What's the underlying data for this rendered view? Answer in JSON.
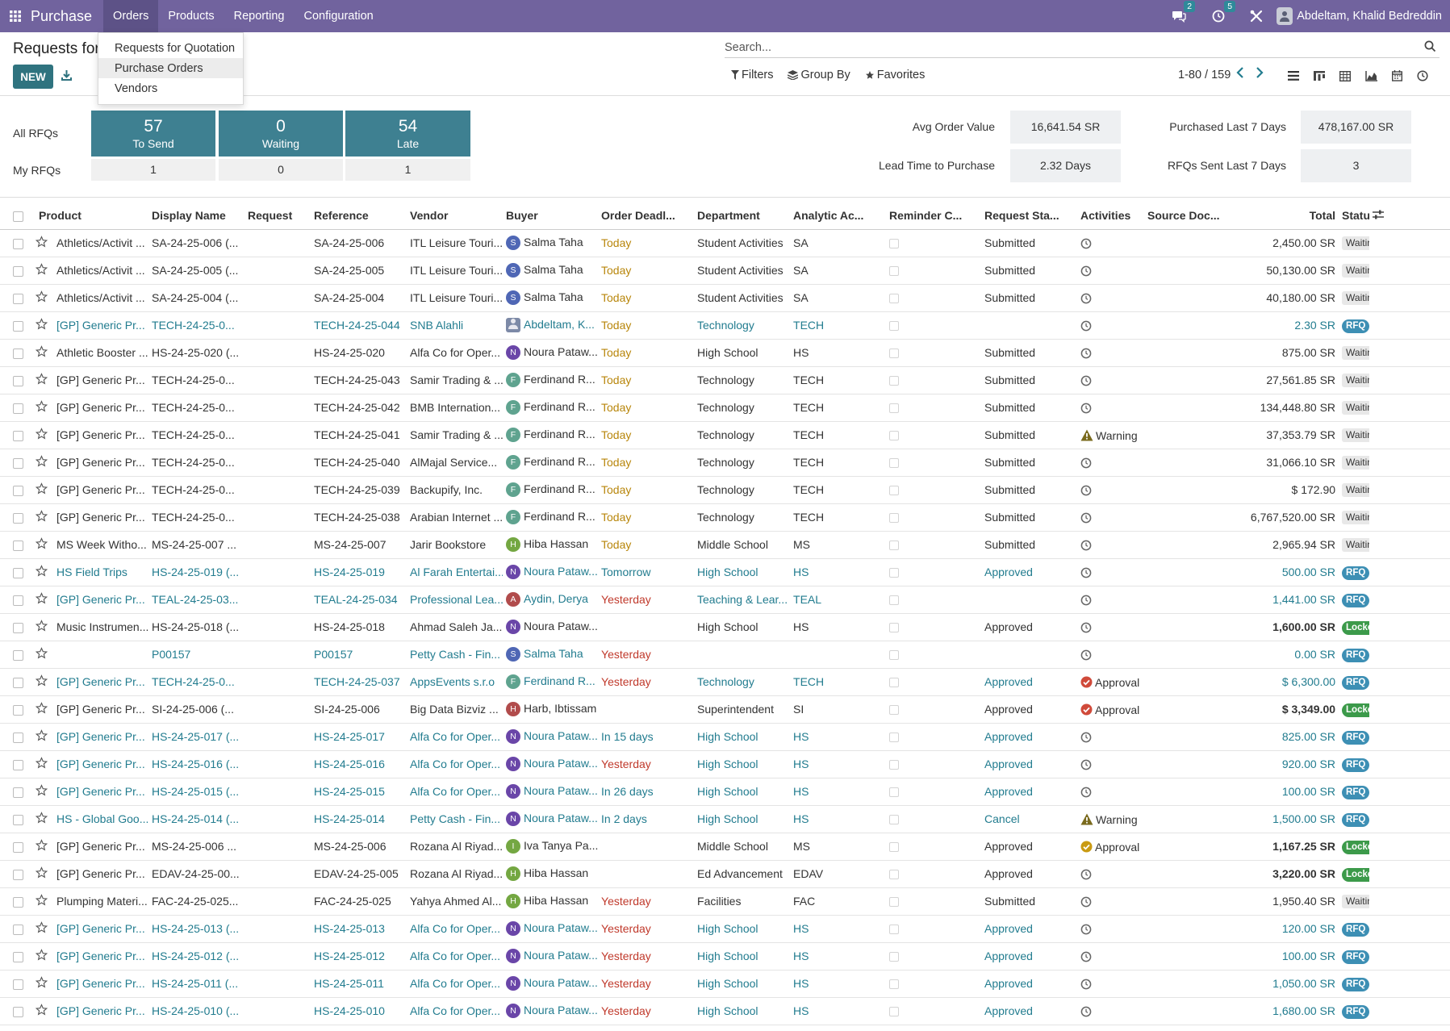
{
  "app": {
    "title": "Purchase"
  },
  "menu": [
    "Orders",
    "Products",
    "Reporting",
    "Configuration"
  ],
  "topbar": {
    "messages_count": "2",
    "activities_count": "5",
    "user_name": "Abdeltam, Khalid Bedreddin"
  },
  "dropdown": [
    "Requests for Quotation",
    "Purchase Orders",
    "Vendors"
  ],
  "page": {
    "title": "Requests for",
    "new_label": "NEW"
  },
  "search": {
    "placeholder": "Search..."
  },
  "filters": {
    "filters": "Filters",
    "group_by": "Group By",
    "favorites": "Favorites"
  },
  "pager": "1-80 / 159",
  "dashboard": {
    "all_rfqs": "All RFQs",
    "my_rfqs": "My RFQs",
    "tiles": [
      {
        "count": "57",
        "label": "To Send",
        "mine": "1"
      },
      {
        "count": "0",
        "label": "Waiting",
        "mine": "0"
      },
      {
        "count": "54",
        "label": "Late",
        "mine": "1"
      }
    ],
    "kpis": [
      {
        "label": "Avg Order Value",
        "value": "16,641.54 SR"
      },
      {
        "label": "Lead Time to Purchase",
        "value": "2.32 Days"
      },
      {
        "label": "Purchased Last 7 Days",
        "value": "478,167.00 SR"
      },
      {
        "label": "RFQs Sent Last 7 Days",
        "value": "3"
      }
    ]
  },
  "columns": [
    "Product",
    "Display Name",
    "Request",
    "Reference",
    "Vendor",
    "Buyer",
    "Order Deadl...",
    "Department",
    "Analytic Ac...",
    "Reminder C...",
    "Request Sta...",
    "Activities",
    "Source Doc...",
    "Total",
    "Status"
  ],
  "rows": [
    {
      "product": "Athletics/Activit ...",
      "display": "SA-24-25-006 (...",
      "ref": "SA-24-25-006",
      "vendor": "ITL Leisure Touri...",
      "buyer": "Salma Taha",
      "av": "S",
      "avc": "b",
      "deadline": "Today",
      "dl": "today",
      "dept": "Student Activities",
      "analytic": "SA",
      "reqstatus": "Submitted",
      "activity": "clock",
      "activity_label": "",
      "total": "2,450.00 SR",
      "status": "Waiting Approval",
      "st": "wait",
      "rfq": false,
      "bold": false
    },
    {
      "product": "Athletics/Activit ...",
      "display": "SA-24-25-005 (...",
      "ref": "SA-24-25-005",
      "vendor": "ITL Leisure Touri...",
      "buyer": "Salma Taha",
      "av": "S",
      "avc": "b",
      "deadline": "Today",
      "dl": "today",
      "dept": "Student Activities",
      "analytic": "SA",
      "reqstatus": "Submitted",
      "activity": "clock",
      "activity_label": "",
      "total": "50,130.00 SR",
      "status": "Waiting Approval",
      "st": "wait",
      "rfq": false,
      "bold": false
    },
    {
      "product": "Athletics/Activit ...",
      "display": "SA-24-25-004 (...",
      "ref": "SA-24-25-004",
      "vendor": "ITL Leisure Touri...",
      "buyer": "Salma Taha",
      "av": "S",
      "avc": "b",
      "deadline": "Today",
      "dl": "today",
      "dept": "Student Activities",
      "analytic": "SA",
      "reqstatus": "Submitted",
      "activity": "clock",
      "activity_label": "",
      "total": "40,180.00 SR",
      "status": "Waiting Approval",
      "st": "wait",
      "rfq": false,
      "bold": false
    },
    {
      "product": "[GP] Generic Pr...",
      "display": "TECH-24-25-0...",
      "ref": "TECH-24-25-044",
      "vendor": "SNB Alahli",
      "buyer": "Abdeltam, K...",
      "av": "",
      "avc": "img",
      "deadline": "Today",
      "dl": "today",
      "dept": "Technology",
      "analytic": "TECH",
      "reqstatus": "",
      "activity": "clock",
      "activity_label": "",
      "total": "2.30 SR",
      "status": "RFQ",
      "st": "rfq",
      "rfq": true,
      "bold": false
    },
    {
      "product": "Athletic Booster ...",
      "display": "HS-24-25-020 (...",
      "ref": "HS-24-25-020",
      "vendor": "Alfa Co for Oper...",
      "buyer": "Noura Pataw...",
      "av": "N",
      "avc": "p",
      "deadline": "Today",
      "dl": "today",
      "dept": "High School",
      "analytic": "HS",
      "reqstatus": "Submitted",
      "activity": "clock",
      "activity_label": "",
      "total": "875.00 SR",
      "status": "Waiting Approval",
      "st": "wait",
      "rfq": false,
      "bold": false
    },
    {
      "product": "[GP] Generic Pr...",
      "display": "TECH-24-25-0...",
      "ref": "TECH-24-25-043",
      "vendor": "Samir Trading & ...",
      "buyer": "Ferdinand R...",
      "av": "F",
      "avc": "g",
      "deadline": "Today",
      "dl": "today",
      "dept": "Technology",
      "analytic": "TECH",
      "reqstatus": "Submitted",
      "activity": "clock",
      "activity_label": "",
      "total": "27,561.85 SR",
      "status": "Waiting Approval",
      "st": "wait",
      "rfq": false,
      "bold": false
    },
    {
      "product": "[GP] Generic Pr...",
      "display": "TECH-24-25-0...",
      "ref": "TECH-24-25-042",
      "vendor": "BMB Internation...",
      "buyer": "Ferdinand R...",
      "av": "F",
      "avc": "g",
      "deadline": "Today",
      "dl": "today",
      "dept": "Technology",
      "analytic": "TECH",
      "reqstatus": "Submitted",
      "activity": "clock",
      "activity_label": "",
      "total": "134,448.80 SR",
      "status": "Waiting Approval",
      "st": "wait",
      "rfq": false,
      "bold": false
    },
    {
      "product": "[GP] Generic Pr...",
      "display": "TECH-24-25-0...",
      "ref": "TECH-24-25-041",
      "vendor": "Samir Trading & ...",
      "buyer": "Ferdinand R...",
      "av": "F",
      "avc": "g",
      "deadline": "Today",
      "dl": "today",
      "dept": "Technology",
      "analytic": "TECH",
      "reqstatus": "Submitted",
      "activity": "warning",
      "activity_label": "Warning",
      "total": "37,353.79 SR",
      "status": "Waiting Approval",
      "st": "wait",
      "rfq": false,
      "bold": false
    },
    {
      "product": "[GP] Generic Pr...",
      "display": "TECH-24-25-0...",
      "ref": "TECH-24-25-040",
      "vendor": "AlMajal Service...",
      "buyer": "Ferdinand R...",
      "av": "F",
      "avc": "g",
      "deadline": "Today",
      "dl": "today",
      "dept": "Technology",
      "analytic": "TECH",
      "reqstatus": "Submitted",
      "activity": "clock",
      "activity_label": "",
      "total": "31,066.10 SR",
      "status": "Waiting Approval",
      "st": "wait",
      "rfq": false,
      "bold": false
    },
    {
      "product": "[GP] Generic Pr...",
      "display": "TECH-24-25-0...",
      "ref": "TECH-24-25-039",
      "vendor": "Backupify, Inc.",
      "buyer": "Ferdinand R...",
      "av": "F",
      "avc": "g",
      "deadline": "Today",
      "dl": "today",
      "dept": "Technology",
      "analytic": "TECH",
      "reqstatus": "Submitted",
      "activity": "clock",
      "activity_label": "",
      "total": "$ 172.90",
      "status": "Waiting Approval",
      "st": "wait",
      "rfq": false,
      "bold": false
    },
    {
      "product": "[GP] Generic Pr...",
      "display": "TECH-24-25-0...",
      "ref": "TECH-24-25-038",
      "vendor": "Arabian Internet ...",
      "buyer": "Ferdinand R...",
      "av": "F",
      "avc": "g",
      "deadline": "Today",
      "dl": "today",
      "dept": "Technology",
      "analytic": "TECH",
      "reqstatus": "Submitted",
      "activity": "clock",
      "activity_label": "",
      "total": "6,767,520.00 SR",
      "status": "Waiting Approval",
      "st": "wait",
      "rfq": false,
      "bold": false
    },
    {
      "product": "MS Week Witho...",
      "display": "MS-24-25-007 ...",
      "ref": "MS-24-25-007",
      "vendor": "Jarir Bookstore",
      "buyer": "Hiba Hassan",
      "av": "H",
      "avc": "gr",
      "deadline": "Today",
      "dl": "today",
      "dept": "Middle School",
      "analytic": "MS",
      "reqstatus": "Submitted",
      "activity": "clock",
      "activity_label": "",
      "total": "2,965.94 SR",
      "status": "Waiting Approval",
      "st": "wait",
      "rfq": false,
      "bold": false
    },
    {
      "product": "HS Field Trips",
      "display": "HS-24-25-019 (...",
      "ref": "HS-24-25-019",
      "vendor": "Al Farah Entertai...",
      "buyer": "Noura Pataw...",
      "av": "N",
      "avc": "p",
      "deadline": "Tomorrow",
      "dl": "fut",
      "dept": "High School",
      "analytic": "HS",
      "reqstatus": "Approved",
      "activity": "clock",
      "activity_label": "",
      "total": "500.00 SR",
      "status": "RFQ",
      "st": "rfq",
      "rfq": true,
      "bold": false
    },
    {
      "product": "[GP] Generic Pr...",
      "display": "TEAL-24-25-03...",
      "ref": "TEAL-24-25-034",
      "vendor": "Professional Lea...",
      "buyer": "Aydin, Derya",
      "av": "A",
      "avc": "r",
      "deadline": "Yesterday",
      "dl": "yest",
      "dept": "Teaching & Lear...",
      "analytic": "TEAL",
      "reqstatus": "",
      "activity": "clock",
      "activity_label": "",
      "total": "1,441.00 SR",
      "status": "RFQ",
      "st": "rfq",
      "rfq": true,
      "bold": false
    },
    {
      "product": "Music Instrumen...",
      "display": "HS-24-25-018 (...",
      "ref": "HS-24-25-018",
      "vendor": "Ahmad Saleh Ja...",
      "buyer": "Noura Pataw...",
      "av": "N",
      "avc": "p",
      "deadline": "",
      "dl": "",
      "dept": "High School",
      "analytic": "HS",
      "reqstatus": "Approved",
      "activity": "clock",
      "activity_label": "",
      "total": "1,600.00 SR",
      "status": "Locked",
      "st": "lock",
      "rfq": false,
      "bold": true
    },
    {
      "product": "",
      "display": "P00157",
      "ref": "P00157",
      "vendor": "Petty Cash - Fin...",
      "buyer": "Salma Taha",
      "av": "S",
      "avc": "b",
      "deadline": "Yesterday",
      "dl": "yest",
      "dept": "",
      "analytic": "",
      "reqstatus": "",
      "activity": "clock",
      "activity_label": "",
      "total": "0.00 SR",
      "status": "RFQ",
      "st": "rfq",
      "rfq": true,
      "bold": false
    },
    {
      "product": "[GP] Generic Pr...",
      "display": "TECH-24-25-0...",
      "ref": "TECH-24-25-037",
      "vendor": "AppsEvents s.r.o",
      "buyer": "Ferdinand R...",
      "av": "F",
      "avc": "g",
      "deadline": "Yesterday",
      "dl": "yest",
      "dept": "Technology",
      "analytic": "TECH",
      "reqstatus": "Approved",
      "activity": "approval-red",
      "activity_label": "Approval",
      "total": "$ 6,300.00",
      "status": "RFQ",
      "st": "rfq",
      "rfq": true,
      "bold": false
    },
    {
      "product": "[GP] Generic Pr...",
      "display": "SI-24-25-006 (...",
      "ref": "SI-24-25-006",
      "vendor": "Big Data Bizviz ...",
      "buyer": "Harb, Ibtissam",
      "av": "H",
      "avc": "r",
      "deadline": "",
      "dl": "",
      "dept": "Superintendent",
      "analytic": "SI",
      "reqstatus": "Approved",
      "activity": "approval-red",
      "activity_label": "Approval",
      "total": "$ 3,349.00",
      "status": "Locked",
      "st": "lock",
      "rfq": false,
      "bold": true
    },
    {
      "product": "[GP] Generic Pr...",
      "display": "HS-24-25-017 (...",
      "ref": "HS-24-25-017",
      "vendor": "Alfa Co for Oper...",
      "buyer": "Noura Pataw...",
      "av": "N",
      "avc": "p",
      "deadline": "In 15 days",
      "dl": "fut",
      "dept": "High School",
      "analytic": "HS",
      "reqstatus": "Approved",
      "activity": "clock",
      "activity_label": "",
      "total": "825.00 SR",
      "status": "RFQ",
      "st": "rfq",
      "rfq": true,
      "bold": false
    },
    {
      "product": "[GP] Generic Pr...",
      "display": "HS-24-25-016 (...",
      "ref": "HS-24-25-016",
      "vendor": "Alfa Co for Oper...",
      "buyer": "Noura Pataw...",
      "av": "N",
      "avc": "p",
      "deadline": "Yesterday",
      "dl": "yest",
      "dept": "High School",
      "analytic": "HS",
      "reqstatus": "Approved",
      "activity": "clock",
      "activity_label": "",
      "total": "920.00 SR",
      "status": "RFQ",
      "st": "rfq",
      "rfq": true,
      "bold": false
    },
    {
      "product": "[GP] Generic Pr...",
      "display": "HS-24-25-015 (...",
      "ref": "HS-24-25-015",
      "vendor": "Alfa Co for Oper...",
      "buyer": "Noura Pataw...",
      "av": "N",
      "avc": "p",
      "deadline": "In 26 days",
      "dl": "fut",
      "dept": "High School",
      "analytic": "HS",
      "reqstatus": "Approved",
      "activity": "clock",
      "activity_label": "",
      "total": "100.00 SR",
      "status": "RFQ",
      "st": "rfq",
      "rfq": true,
      "bold": false
    },
    {
      "product": "HS - Global Goo...",
      "display": "HS-24-25-014 (...",
      "ref": "HS-24-25-014",
      "vendor": "Petty Cash - Fin...",
      "buyer": "Noura Pataw...",
      "av": "N",
      "avc": "p",
      "deadline": "In 2 days",
      "dl": "fut",
      "dept": "High School",
      "analytic": "HS",
      "reqstatus": "Cancel",
      "activity": "warning",
      "activity_label": "Warning",
      "total": "1,500.00 SR",
      "status": "RFQ",
      "st": "rfq",
      "rfq": true,
      "bold": false
    },
    {
      "product": "[GP] Generic Pr...",
      "display": "MS-24-25-006 ...",
      "ref": "MS-24-25-006",
      "vendor": "Rozana Al Riyad...",
      "buyer": "Iva Tanya Pa...",
      "av": "I",
      "avc": "gr",
      "deadline": "",
      "dl": "",
      "dept": "Middle School",
      "analytic": "MS",
      "reqstatus": "Approved",
      "activity": "approval-gold",
      "activity_label": "Approval",
      "total": "1,167.25 SR",
      "status": "Locked",
      "st": "lock",
      "rfq": false,
      "bold": true
    },
    {
      "product": "[GP] Generic Pr...",
      "display": "EDAV-24-25-00...",
      "ref": "EDAV-24-25-005",
      "vendor": "Rozana Al Riyad...",
      "buyer": "Hiba Hassan",
      "av": "H",
      "avc": "gr",
      "deadline": "",
      "dl": "",
      "dept": "Ed Advancement",
      "analytic": "EDAV",
      "reqstatus": "Approved",
      "activity": "clock",
      "activity_label": "",
      "total": "3,220.00 SR",
      "status": "Locked",
      "st": "lock",
      "rfq": false,
      "bold": true
    },
    {
      "product": "Plumping Materi...",
      "display": "FAC-24-25-025...",
      "ref": "FAC-24-25-025",
      "vendor": "Yahya Ahmed Al...",
      "buyer": "Hiba Hassan",
      "av": "H",
      "avc": "gr",
      "deadline": "Yesterday",
      "dl": "yest",
      "dept": "Facilities",
      "analytic": "FAC",
      "reqstatus": "Submitted",
      "activity": "clock",
      "activity_label": "",
      "total": "1,950.40 SR",
      "status": "Waiting Approval",
      "st": "wait",
      "rfq": false,
      "bold": false
    },
    {
      "product": "[GP] Generic Pr...",
      "display": "HS-24-25-013 (...",
      "ref": "HS-24-25-013",
      "vendor": "Alfa Co for Oper...",
      "buyer": "Noura Pataw...",
      "av": "N",
      "avc": "p",
      "deadline": "Yesterday",
      "dl": "yest",
      "dept": "High School",
      "analytic": "HS",
      "reqstatus": "Approved",
      "activity": "clock",
      "activity_label": "",
      "total": "120.00 SR",
      "status": "RFQ",
      "st": "rfq",
      "rfq": true,
      "bold": false
    },
    {
      "product": "[GP] Generic Pr...",
      "display": "HS-24-25-012 (...",
      "ref": "HS-24-25-012",
      "vendor": "Alfa Co for Oper...",
      "buyer": "Noura Pataw...",
      "av": "N",
      "avc": "p",
      "deadline": "Yesterday",
      "dl": "yest",
      "dept": "High School",
      "analytic": "HS",
      "reqstatus": "Approved",
      "activity": "clock",
      "activity_label": "",
      "total": "100.00 SR",
      "status": "RFQ",
      "st": "rfq",
      "rfq": true,
      "bold": false
    },
    {
      "product": "[GP] Generic Pr...",
      "display": "HS-24-25-011 (...",
      "ref": "HS-24-25-011",
      "vendor": "Alfa Co for Oper...",
      "buyer": "Noura Pataw...",
      "av": "N",
      "avc": "p",
      "deadline": "Yesterday",
      "dl": "yest",
      "dept": "High School",
      "analytic": "HS",
      "reqstatus": "Approved",
      "activity": "clock",
      "activity_label": "",
      "total": "1,050.00 SR",
      "status": "RFQ",
      "st": "rfq",
      "rfq": true,
      "bold": false
    },
    {
      "product": "[GP] Generic Pr...",
      "display": "HS-24-25-010 (...",
      "ref": "HS-24-25-010",
      "vendor": "Alfa Co for Oper...",
      "buyer": "Noura Pataw...",
      "av": "N",
      "avc": "p",
      "deadline": "Yesterday",
      "dl": "yest",
      "dept": "High School",
      "analytic": "HS",
      "reqstatus": "Approved",
      "activity": "clock",
      "activity_label": "",
      "total": "1,680.00 SR",
      "status": "RFQ",
      "st": "rfq",
      "rfq": true,
      "bold": false
    }
  ]
}
